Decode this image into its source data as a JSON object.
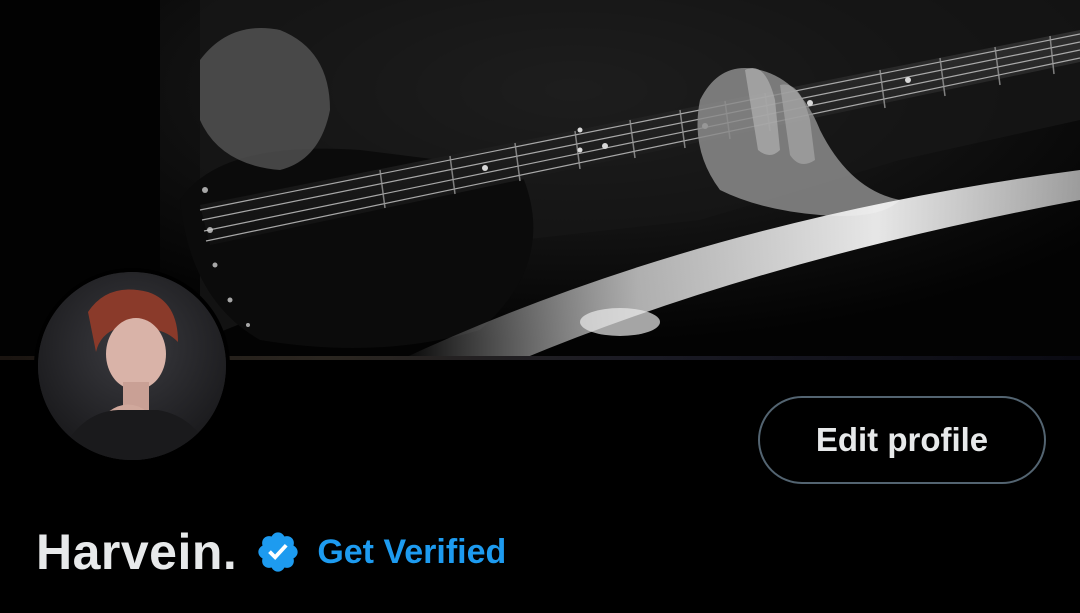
{
  "profile": {
    "display_name": "Harvein.",
    "get_verified_label": "Get Verified",
    "edit_profile_label": "Edit profile"
  },
  "icons": {
    "verified": "verified-badge-icon"
  },
  "colors": {
    "background": "#000000",
    "text_primary": "#e7e9ea",
    "accent": "#1d9bf0",
    "button_border": "#536471"
  }
}
